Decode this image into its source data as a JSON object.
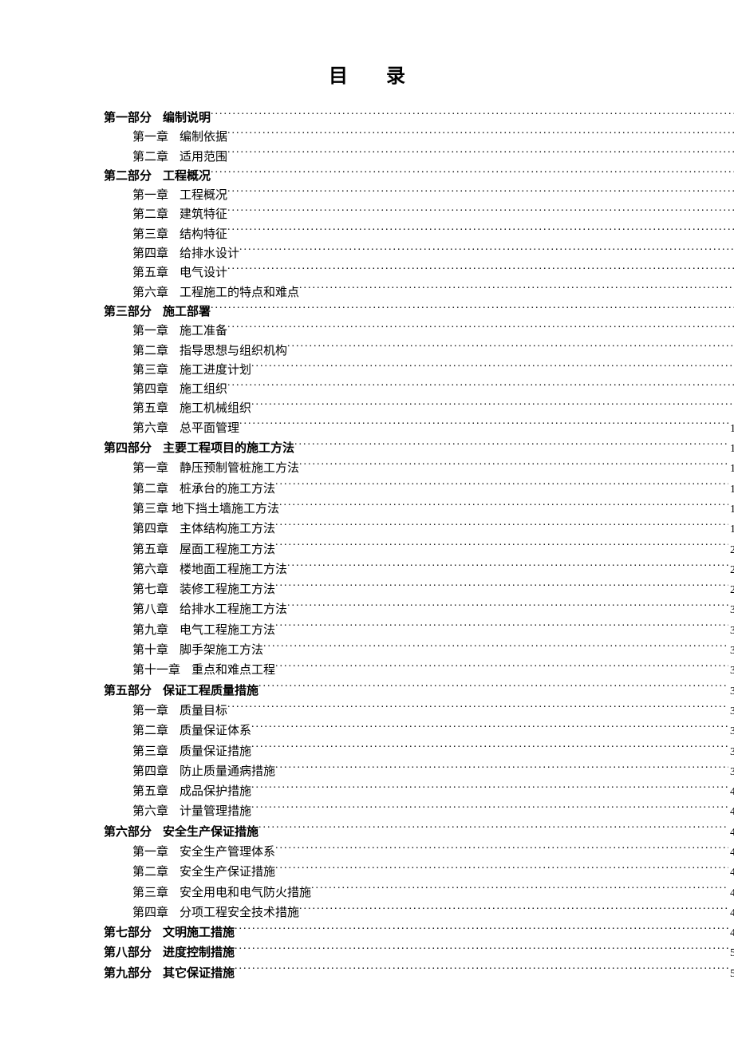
{
  "title": "目录",
  "toc": [
    {
      "level": 0,
      "prefix": "第一部分",
      "text": "编制说明",
      "page": ""
    },
    {
      "level": 1,
      "prefix": "第一章",
      "text": "编制依据",
      "page": ""
    },
    {
      "level": 1,
      "prefix": "第二章",
      "text": "适用范围",
      "page": ""
    },
    {
      "level": 0,
      "prefix": "第二部分",
      "text": "工程概况",
      "page": ""
    },
    {
      "level": 1,
      "prefix": "第一章",
      "text": "工程概况",
      "page": ""
    },
    {
      "level": 1,
      "prefix": "第二章",
      "text": "建筑特征",
      "page": ""
    },
    {
      "level": 1,
      "prefix": "第三章",
      "text": "结构特征",
      "page": ""
    },
    {
      "level": 1,
      "prefix": "第四章",
      "text": "给排水设计",
      "page": ""
    },
    {
      "level": 1,
      "prefix": "第五章",
      "text": "电气设计",
      "page": ""
    },
    {
      "level": 1,
      "prefix": "第六章",
      "text": "工程施工的特点和难点",
      "page": ""
    },
    {
      "level": 0,
      "prefix": "第三部分",
      "text": "施工部署",
      "page": ""
    },
    {
      "level": 1,
      "prefix": "第一章",
      "text": "施工准备",
      "page": ""
    },
    {
      "level": 1,
      "prefix": "第二章",
      "text": "指导思想与组织机构",
      "page": ""
    },
    {
      "level": 1,
      "prefix": "第三章",
      "text": "施工进度计划",
      "page": ""
    },
    {
      "level": 1,
      "prefix": "第四章",
      "text": "施工组织",
      "page": ""
    },
    {
      "level": 1,
      "prefix": "第五章",
      "text": "施工机械组织",
      "page": ""
    },
    {
      "level": 1,
      "prefix": "第六章",
      "text": "总平面管理",
      "page": "1"
    },
    {
      "level": 0,
      "prefix": "第四部分",
      "text": "主要工程项目的施工方法",
      "page": "1"
    },
    {
      "level": 1,
      "prefix": "第一章",
      "text": "静压预制管桩施工方法",
      "page": "1"
    },
    {
      "level": 1,
      "prefix": "第二章",
      "text": "桩承台的施工方法",
      "page": "1"
    },
    {
      "level": 1,
      "prefix": "第三章",
      "text": "地下挡土墙施工方法",
      "page": "1",
      "tight": true
    },
    {
      "level": 1,
      "prefix": "第四章",
      "text": "主体结构施工方法",
      "page": "1"
    },
    {
      "level": 1,
      "prefix": "第五章",
      "text": "屋面工程施工方法",
      "page": "2"
    },
    {
      "level": 1,
      "prefix": "第六章",
      "text": "楼地面工程施工方法",
      "page": "2"
    },
    {
      "level": 1,
      "prefix": "第七章",
      "text": "装修工程施工方法",
      "page": "2"
    },
    {
      "level": 1,
      "prefix": "第八章",
      "text": "给排水工程施工方法",
      "page": "3"
    },
    {
      "level": 1,
      "prefix": "第九章",
      "text": "电气工程施工方法",
      "page": "3"
    },
    {
      "level": 1,
      "prefix": "第十章",
      "text": "脚手架施工方法",
      "page": "3"
    },
    {
      "level": 1,
      "prefix": "第十一章",
      "text": "重点和难点工程",
      "page": "3"
    },
    {
      "level": 0,
      "prefix": "第五部分",
      "text": "保证工程质量措施",
      "page": "3"
    },
    {
      "level": 1,
      "prefix": "第一章",
      "text": "质量目标",
      "page": "3"
    },
    {
      "level": 1,
      "prefix": "第二章",
      "text": "质量保证体系",
      "page": "3"
    },
    {
      "level": 1,
      "prefix": "第三章",
      "text": "质量保证措施",
      "page": "3"
    },
    {
      "level": 1,
      "prefix": "第四章",
      "text": "防止质量通病措施",
      "page": "3"
    },
    {
      "level": 1,
      "prefix": "第五章",
      "text": "成品保护措施",
      "page": "4"
    },
    {
      "level": 1,
      "prefix": "第六章",
      "text": "计量管理措施",
      "page": "4"
    },
    {
      "level": 0,
      "prefix": "第六部分",
      "text": "安全生产保证措施",
      "page": "4"
    },
    {
      "level": 1,
      "prefix": "第一章",
      "text": "安全生产管理体系",
      "page": "4"
    },
    {
      "level": 1,
      "prefix": "第二章",
      "text": "安全生产保证措施",
      "page": "4"
    },
    {
      "level": 1,
      "prefix": "第三章",
      "text": "安全用电和电气防火措施",
      "page": "4"
    },
    {
      "level": 1,
      "prefix": "第四章",
      "text": "分项工程安全技术措施",
      "page": "4"
    },
    {
      "level": 0,
      "prefix": "第七部分",
      "text": "文明施工措施",
      "page": "4"
    },
    {
      "level": 0,
      "prefix": "第八部分",
      "text": "进度控制措施",
      "page": "5"
    },
    {
      "level": 0,
      "prefix": "第九部分",
      "text": "其它保证措施",
      "page": "5"
    }
  ]
}
